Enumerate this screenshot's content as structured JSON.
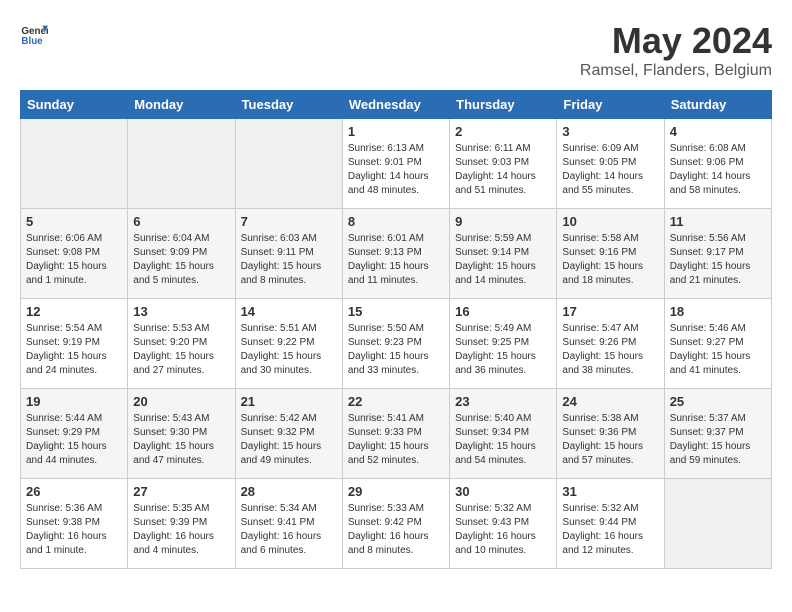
{
  "header": {
    "logo_line1": "General",
    "logo_line2": "Blue",
    "month": "May 2024",
    "location": "Ramsel, Flanders, Belgium"
  },
  "columns": [
    "Sunday",
    "Monday",
    "Tuesday",
    "Wednesday",
    "Thursday",
    "Friday",
    "Saturday"
  ],
  "weeks": [
    [
      {
        "day": "",
        "info": ""
      },
      {
        "day": "",
        "info": ""
      },
      {
        "day": "",
        "info": ""
      },
      {
        "day": "1",
        "info": "Sunrise: 6:13 AM\nSunset: 9:01 PM\nDaylight: 14 hours\nand 48 minutes."
      },
      {
        "day": "2",
        "info": "Sunrise: 6:11 AM\nSunset: 9:03 PM\nDaylight: 14 hours\nand 51 minutes."
      },
      {
        "day": "3",
        "info": "Sunrise: 6:09 AM\nSunset: 9:05 PM\nDaylight: 14 hours\nand 55 minutes."
      },
      {
        "day": "4",
        "info": "Sunrise: 6:08 AM\nSunset: 9:06 PM\nDaylight: 14 hours\nand 58 minutes."
      }
    ],
    [
      {
        "day": "5",
        "info": "Sunrise: 6:06 AM\nSunset: 9:08 PM\nDaylight: 15 hours\nand 1 minute."
      },
      {
        "day": "6",
        "info": "Sunrise: 6:04 AM\nSunset: 9:09 PM\nDaylight: 15 hours\nand 5 minutes."
      },
      {
        "day": "7",
        "info": "Sunrise: 6:03 AM\nSunset: 9:11 PM\nDaylight: 15 hours\nand 8 minutes."
      },
      {
        "day": "8",
        "info": "Sunrise: 6:01 AM\nSunset: 9:13 PM\nDaylight: 15 hours\nand 11 minutes."
      },
      {
        "day": "9",
        "info": "Sunrise: 5:59 AM\nSunset: 9:14 PM\nDaylight: 15 hours\nand 14 minutes."
      },
      {
        "day": "10",
        "info": "Sunrise: 5:58 AM\nSunset: 9:16 PM\nDaylight: 15 hours\nand 18 minutes."
      },
      {
        "day": "11",
        "info": "Sunrise: 5:56 AM\nSunset: 9:17 PM\nDaylight: 15 hours\nand 21 minutes."
      }
    ],
    [
      {
        "day": "12",
        "info": "Sunrise: 5:54 AM\nSunset: 9:19 PM\nDaylight: 15 hours\nand 24 minutes."
      },
      {
        "day": "13",
        "info": "Sunrise: 5:53 AM\nSunset: 9:20 PM\nDaylight: 15 hours\nand 27 minutes."
      },
      {
        "day": "14",
        "info": "Sunrise: 5:51 AM\nSunset: 9:22 PM\nDaylight: 15 hours\nand 30 minutes."
      },
      {
        "day": "15",
        "info": "Sunrise: 5:50 AM\nSunset: 9:23 PM\nDaylight: 15 hours\nand 33 minutes."
      },
      {
        "day": "16",
        "info": "Sunrise: 5:49 AM\nSunset: 9:25 PM\nDaylight: 15 hours\nand 36 minutes."
      },
      {
        "day": "17",
        "info": "Sunrise: 5:47 AM\nSunset: 9:26 PM\nDaylight: 15 hours\nand 38 minutes."
      },
      {
        "day": "18",
        "info": "Sunrise: 5:46 AM\nSunset: 9:27 PM\nDaylight: 15 hours\nand 41 minutes."
      }
    ],
    [
      {
        "day": "19",
        "info": "Sunrise: 5:44 AM\nSunset: 9:29 PM\nDaylight: 15 hours\nand 44 minutes."
      },
      {
        "day": "20",
        "info": "Sunrise: 5:43 AM\nSunset: 9:30 PM\nDaylight: 15 hours\nand 47 minutes."
      },
      {
        "day": "21",
        "info": "Sunrise: 5:42 AM\nSunset: 9:32 PM\nDaylight: 15 hours\nand 49 minutes."
      },
      {
        "day": "22",
        "info": "Sunrise: 5:41 AM\nSunset: 9:33 PM\nDaylight: 15 hours\nand 52 minutes."
      },
      {
        "day": "23",
        "info": "Sunrise: 5:40 AM\nSunset: 9:34 PM\nDaylight: 15 hours\nand 54 minutes."
      },
      {
        "day": "24",
        "info": "Sunrise: 5:38 AM\nSunset: 9:36 PM\nDaylight: 15 hours\nand 57 minutes."
      },
      {
        "day": "25",
        "info": "Sunrise: 5:37 AM\nSunset: 9:37 PM\nDaylight: 15 hours\nand 59 minutes."
      }
    ],
    [
      {
        "day": "26",
        "info": "Sunrise: 5:36 AM\nSunset: 9:38 PM\nDaylight: 16 hours\nand 1 minute."
      },
      {
        "day": "27",
        "info": "Sunrise: 5:35 AM\nSunset: 9:39 PM\nDaylight: 16 hours\nand 4 minutes."
      },
      {
        "day": "28",
        "info": "Sunrise: 5:34 AM\nSunset: 9:41 PM\nDaylight: 16 hours\nand 6 minutes."
      },
      {
        "day": "29",
        "info": "Sunrise: 5:33 AM\nSunset: 9:42 PM\nDaylight: 16 hours\nand 8 minutes."
      },
      {
        "day": "30",
        "info": "Sunrise: 5:32 AM\nSunset: 9:43 PM\nDaylight: 16 hours\nand 10 minutes."
      },
      {
        "day": "31",
        "info": "Sunrise: 5:32 AM\nSunset: 9:44 PM\nDaylight: 16 hours\nand 12 minutes."
      },
      {
        "day": "",
        "info": ""
      }
    ]
  ]
}
